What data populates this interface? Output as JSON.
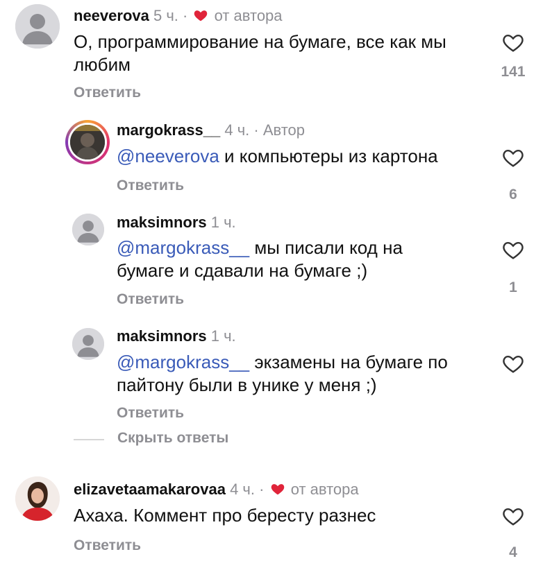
{
  "comments": [
    {
      "username": "neeverova",
      "time": "5 ч.",
      "dot": "·",
      "author_like": "от автора",
      "text": "О, программирование на бумаге, все как мы любим",
      "reply": "Ответить",
      "likes": "141"
    },
    {
      "username": "margokrass__",
      "time": "4 ч.",
      "dot": "·",
      "badge": "Автор",
      "mention": "@neeverova",
      "text": " и компьютеры из картона",
      "reply": "Ответить",
      "likes": "6"
    },
    {
      "username": "maksimnors",
      "time": "1 ч.",
      "mention": "@margokrass__",
      "text": " мы писали код на бумаге и сдавали на бумаге ;)",
      "reply": "Ответить",
      "likes": "1"
    },
    {
      "username": "maksimnors",
      "time": "1 ч.",
      "mention": "@margokrass__",
      "text": " экзамены на бумаге по пайтону были в унике у меня ;)",
      "reply": "Ответить",
      "likes": ""
    },
    {
      "username": "elizavetaamakarovaa",
      "time": "4 ч.",
      "dot": "·",
      "author_like": "от автора",
      "text": "Ахаха. Коммент про бересту разнес",
      "reply": "Ответить",
      "likes": "4"
    }
  ],
  "hide_replies": "Скрыть ответы",
  "colors": {
    "mention": "#3a5bb8",
    "muted": "#8e8e93",
    "author_heart": "#e0243a"
  },
  "icons": {
    "like": "heart-outline-icon",
    "author_like": "heart-filled-icon",
    "avatar_default": "person-placeholder-icon"
  }
}
